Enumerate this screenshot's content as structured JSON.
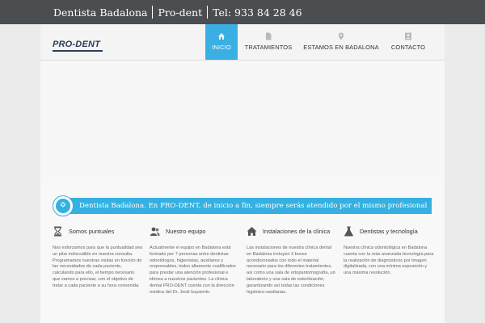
{
  "topbar": {
    "part1": "Dentista Badalona",
    "part2": "Pro-dent",
    "part3": "Tel: 933 84 28 46"
  },
  "logo": {
    "text": "PRO-DENT"
  },
  "nav": [
    {
      "label": "INICIO",
      "icon": "home-icon"
    },
    {
      "label": "TRATAMIENTOS",
      "icon": "document-icon"
    },
    {
      "label": "ESTAMOS EN BADALONA",
      "icon": "location-pin-icon"
    },
    {
      "label": "CONTACTO",
      "icon": "contact-card-icon"
    }
  ],
  "banner": {
    "text": "Dentista Badalona. En PRO-DENT, de inicio a fin, siempre serás atendido por el mismo profesional",
    "icon": "star-of-david-icon"
  },
  "features": [
    {
      "title": "Somos puntuales",
      "icon": "hourglass-icon",
      "body": "Nos esforzamos para que la puntualidad sea un pilar indiscutible en nuestra consulta. Programamos nuestras visitas en función de las necesidades de cada paciente, calculando para ello, el tiempo necesario que vamos a precisar, con el objetivo de tratar a cada paciente a su hora convenida."
    },
    {
      "title": "Nuestro equipo",
      "icon": "team-icon",
      "body": "Actualmente el equipo en Badalona está formado por 7 personas entre dentistas odontólogos, higienistas, auxiliares y responsables, todos altamente cualificados para prestar una atención profesional e idónea a nuestros pacientes. La clínica dental PRO-DENT cuenta con la dirección médica del Dr. Jordi Izquierdo."
    },
    {
      "title": "Instalaciones de la clínica",
      "icon": "house-icon",
      "body": "Las instalaciones de nuestra clínica dental en Badalona incluyen 3 boxes acondicionados con todo el material necesario para los diferentes tratamientos, así como una sala de ortopantomografía, un laboratorio y una sala de esterilización, garantizando así todas las condiciones higiénico-sanitarias."
    },
    {
      "title": "Dentistas y tecnología",
      "icon": "flask-icon",
      "body": "Nuestra clínica odontológica en Badalona cuenta con la más avanzada tecnología para la realización de diagnósticos por imagen digitalizada, con una mínima exposición y una máxima resolución."
    }
  ],
  "colors": {
    "accent": "#35b0e2",
    "topbar": "#4a4e51",
    "logo": "#2c3e58"
  }
}
